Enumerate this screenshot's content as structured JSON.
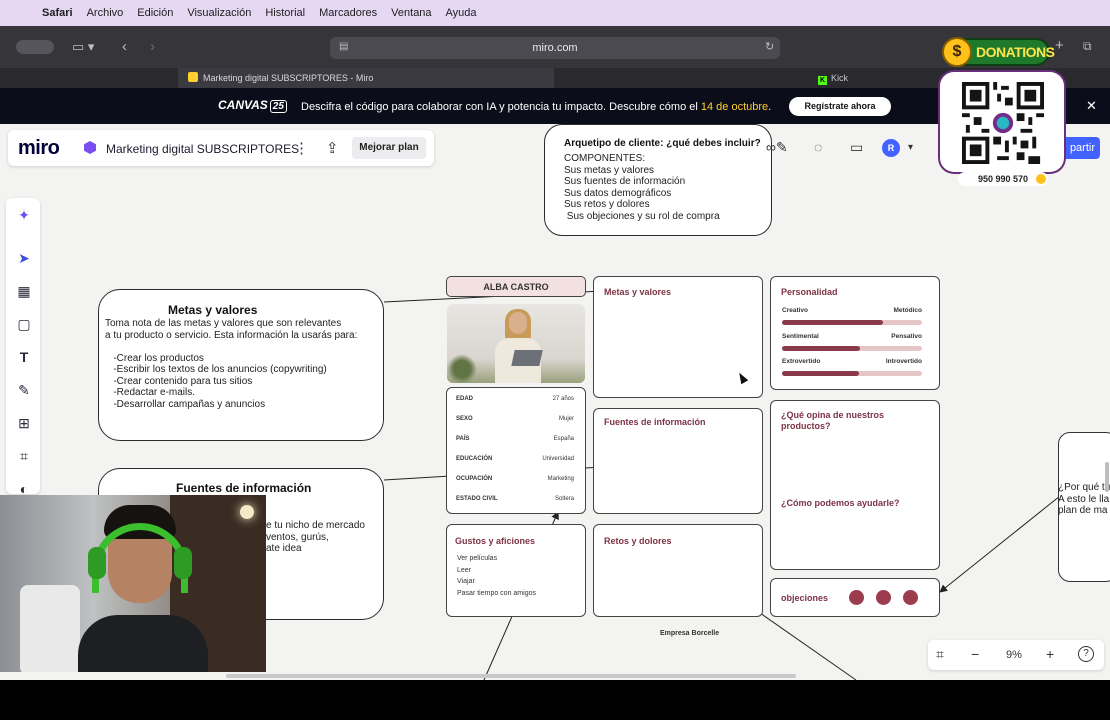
{
  "menubar": {
    "app": "Safari",
    "items": [
      "Archivo",
      "Edición",
      "Visualización",
      "Historial",
      "Marcadores",
      "Ventana",
      "Ayuda"
    ]
  },
  "browser": {
    "url": "miro.com",
    "tab_active": "Marketing digital SUBSCRIPTORES - Miro",
    "tab_other": "Kick"
  },
  "banner": {
    "logo_text": "CANVAS",
    "logo_badge": "25",
    "text": "Descifra el código para colaborar con IA y potencia tu impacto. Descubre cómo el ",
    "date": "14 de octubre",
    "text_end": ".",
    "cta": "Regístrate ahora"
  },
  "miro": {
    "logo": "miro",
    "board_name": "Marketing digital SUBSCRIPTORES",
    "upgrade": "Mejorar plan",
    "avatar_initial": "R",
    "share_label": "partir",
    "zoom": "9%"
  },
  "notes": {
    "arquetipo": {
      "title": "Arquetipo de cliente: ¿qué debes incluir?",
      "body": "COMPONENTES:\nSus metas y valores\nSus fuentes de información\nSus datos demográficos\nSus retos y dolores\n Sus objeciones y su rol de compra"
    },
    "metas": {
      "title": "Metas y valores",
      "body": "Toma nota de las metas y valores que son relevantes\na tu producto o servicio. Esta información la usarás para:\n\n   -Crear los productos\n   -Escribir los textos de los anuncios (copywriting)\n   -Crear contenido para tus sitios\n   -Redactar e-mails.\n   -Desarrollar campañas y anuncios"
    },
    "fuentes": {
      "title": "Fuentes de información",
      "body": "e tu nicho de mercado\nventos, gurús,\nate idea"
    },
    "right": {
      "body": "¿Por qué tu\nA esto le lla\nplan de ma"
    }
  },
  "persona": {
    "name": "ALBA CASTRO",
    "info": [
      {
        "k": "EDAD",
        "v": "27 años"
      },
      {
        "k": "SEXO",
        "v": "Mujer"
      },
      {
        "k": "PAÍS",
        "v": "España"
      },
      {
        "k": "EDUCACIÓN",
        "v": "Universidad"
      },
      {
        "k": "OCUPACIÓN",
        "v": "Marketing"
      },
      {
        "k": "ESTADO CIVIL",
        "v": "Soltera"
      }
    ],
    "metas_title": "Metas y valores",
    "personalidad_title": "Personalidad",
    "traits": [
      {
        "left": "Creativo",
        "right": "Metódico",
        "level": 0.72
      },
      {
        "left": "Sentimental",
        "right": "Pensativo",
        "level": 0.56
      },
      {
        "left": "Extrovertido",
        "right": "Introvertido",
        "level": 0.55
      }
    ],
    "fuentes_title": "Fuentes de información",
    "opina_title": "¿Qué opina de nuestros productos?",
    "ayudarle_title": "¿Cómo podemos ayudarle?",
    "gustos_title": "Gustos y aficiones",
    "gustos": "Ver películas\nLeer\nViajar\nPasar tiempo con amigos",
    "retos_title": "Retos y dolores",
    "objeciones_title": "objeciones",
    "empresa": "Empresa Borcelle"
  },
  "overlay": {
    "donations": "DONATIONS",
    "coin": "$",
    "phone": "950 990 570"
  }
}
